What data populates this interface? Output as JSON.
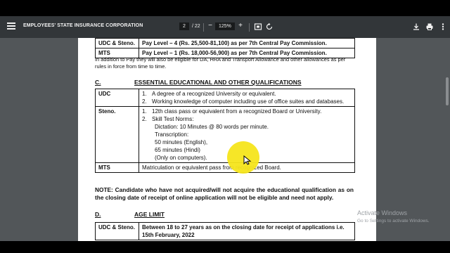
{
  "toolbar": {
    "title": "EMPLOYEES' STATE INSURANCE CORPORATION",
    "current_page": "2",
    "total_pages": "/ 22",
    "zoom": "125%",
    "zoom_out": "−",
    "zoom_in": "+"
  },
  "pay_table": {
    "rows": [
      {
        "post": "UDC & Steno.",
        "pay": "Pay Level – 4 (Rs. 25,500-81,100) as per 7th Central Pay Commission."
      },
      {
        "post": "MTS",
        "pay": "Pay Level – 1 (Rs. 18,000-56,900) as per 7th Central Pay Commission."
      }
    ]
  },
  "allowance_note": "In addition to Pay they will also be eligible for DA, HRA and Transport Allowance and other allowances as per rules in force from time to time.",
  "section_c": {
    "letter": "C.",
    "title": "ESSENTIAL EDUCATIONAL AND OTHER QUALIFICATIONS",
    "udc": {
      "post": "UDC",
      "items": [
        {
          "n": "1.",
          "text": "A degree of a recognized University or equivalent."
        },
        {
          "n": "2.",
          "text": "Working knowledge of computer including use of office suites and databases."
        }
      ]
    },
    "steno": {
      "post": "Steno.",
      "item1_n": "1.",
      "item1": "12th class pass or equivalent from a recognized Board or University.",
      "item2_n": "2.",
      "item2": "Skill Test Norms:",
      "sub": [
        "Dictation: 10 Minutes @ 80 words per minute.",
        "Transcription:",
        "50 minutes (English),",
        "65 minutes (Hindi)",
        "(Only on computers)."
      ]
    },
    "mts": {
      "post": "MTS",
      "text": "Matriculation or equivalent pass from recognized Board."
    }
  },
  "note": "NOTE: Candidate who have not acquired/will not acquire the educational qualification as on the closing date of receipt of online application will not be eligible and need not apply.",
  "section_d": {
    "letter": "D.",
    "title": "AGE LIMIT",
    "row": {
      "post": "UDC & Steno.",
      "text": "Between 18 to 27 years as on the closing date for receipt of applications i.e. 15th February, 2022"
    }
  },
  "watermark": {
    "line1": "Activate Windows",
    "line2": "Go to Settings to activate Windows."
  },
  "colors": {
    "toolbar": "#323639",
    "viewer_bg": "#525659",
    "cursor_highlight": "#f6e51b"
  },
  "icons": [
    "menu-icon",
    "fit-page-icon",
    "rotate-icon",
    "download-icon",
    "print-icon",
    "more-vert-icon",
    "mouse-cursor-icon"
  ]
}
